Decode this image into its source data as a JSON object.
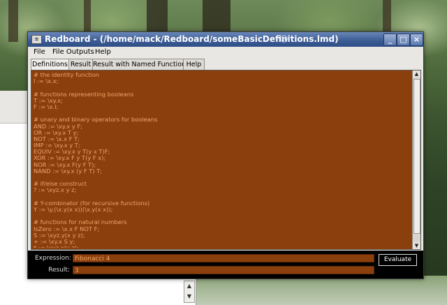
{
  "window": {
    "title": "Redboard - (/home/mack/Redboard/someBasicDefinitions.lmd)",
    "controls": [
      "_",
      "□",
      "×"
    ]
  },
  "menu": [
    "File",
    "File Outputs",
    "Help"
  ],
  "tabs": [
    {
      "label": "Definitions",
      "active": true
    },
    {
      "label": "Result",
      "active": false
    },
    {
      "label": "Result with Named Functions",
      "active": false
    },
    {
      "label": "Help",
      "active": false
    }
  ],
  "code_lines": [
    "# the identity function",
    "I := \\x.x;",
    "",
    "# functions representing booleans",
    "T := \\xy.x;",
    "F := \\x.I;",
    "",
    "# unary and binary operators for booleans",
    "AND := \\xy.x y F;",
    "OR := \\xy.x T y;",
    "NOT := \\x.x F T;",
    "IMP := \\xy.x y T;",
    "EQUIV := \\xy.x y T(y x T)F;",
    "XOR := \\xy.x F y T(y F x);",
    "NOR := \\xy.x F(y F T);",
    "NAND := \\xy.x (y F T) T;",
    "",
    "# if/else construct",
    "? := \\xyz.x y z;",
    "",
    "# Y-combinator (for recursive functions)",
    "Y := \\y.(\\x.y(x x))(\\x.y(x x));",
    "",
    "# functions for natural numbers",
    "IsZero := \\x.x F NOT F;",
    "S := \\xyz.y(x y z);",
    "+ := \\xy.x S y;",
    "* := \\xyz.x(y z);"
  ],
  "expression": {
    "label": "Expression:",
    "value": "Fibonacci 4"
  },
  "result": {
    "label": "Result:",
    "value": "3"
  },
  "evaluate_label": "Evaluate",
  "colors": {
    "editor_bg": "#8b3f0d",
    "code_text": "#f2a46a",
    "title_bar": "#3e5e96"
  }
}
